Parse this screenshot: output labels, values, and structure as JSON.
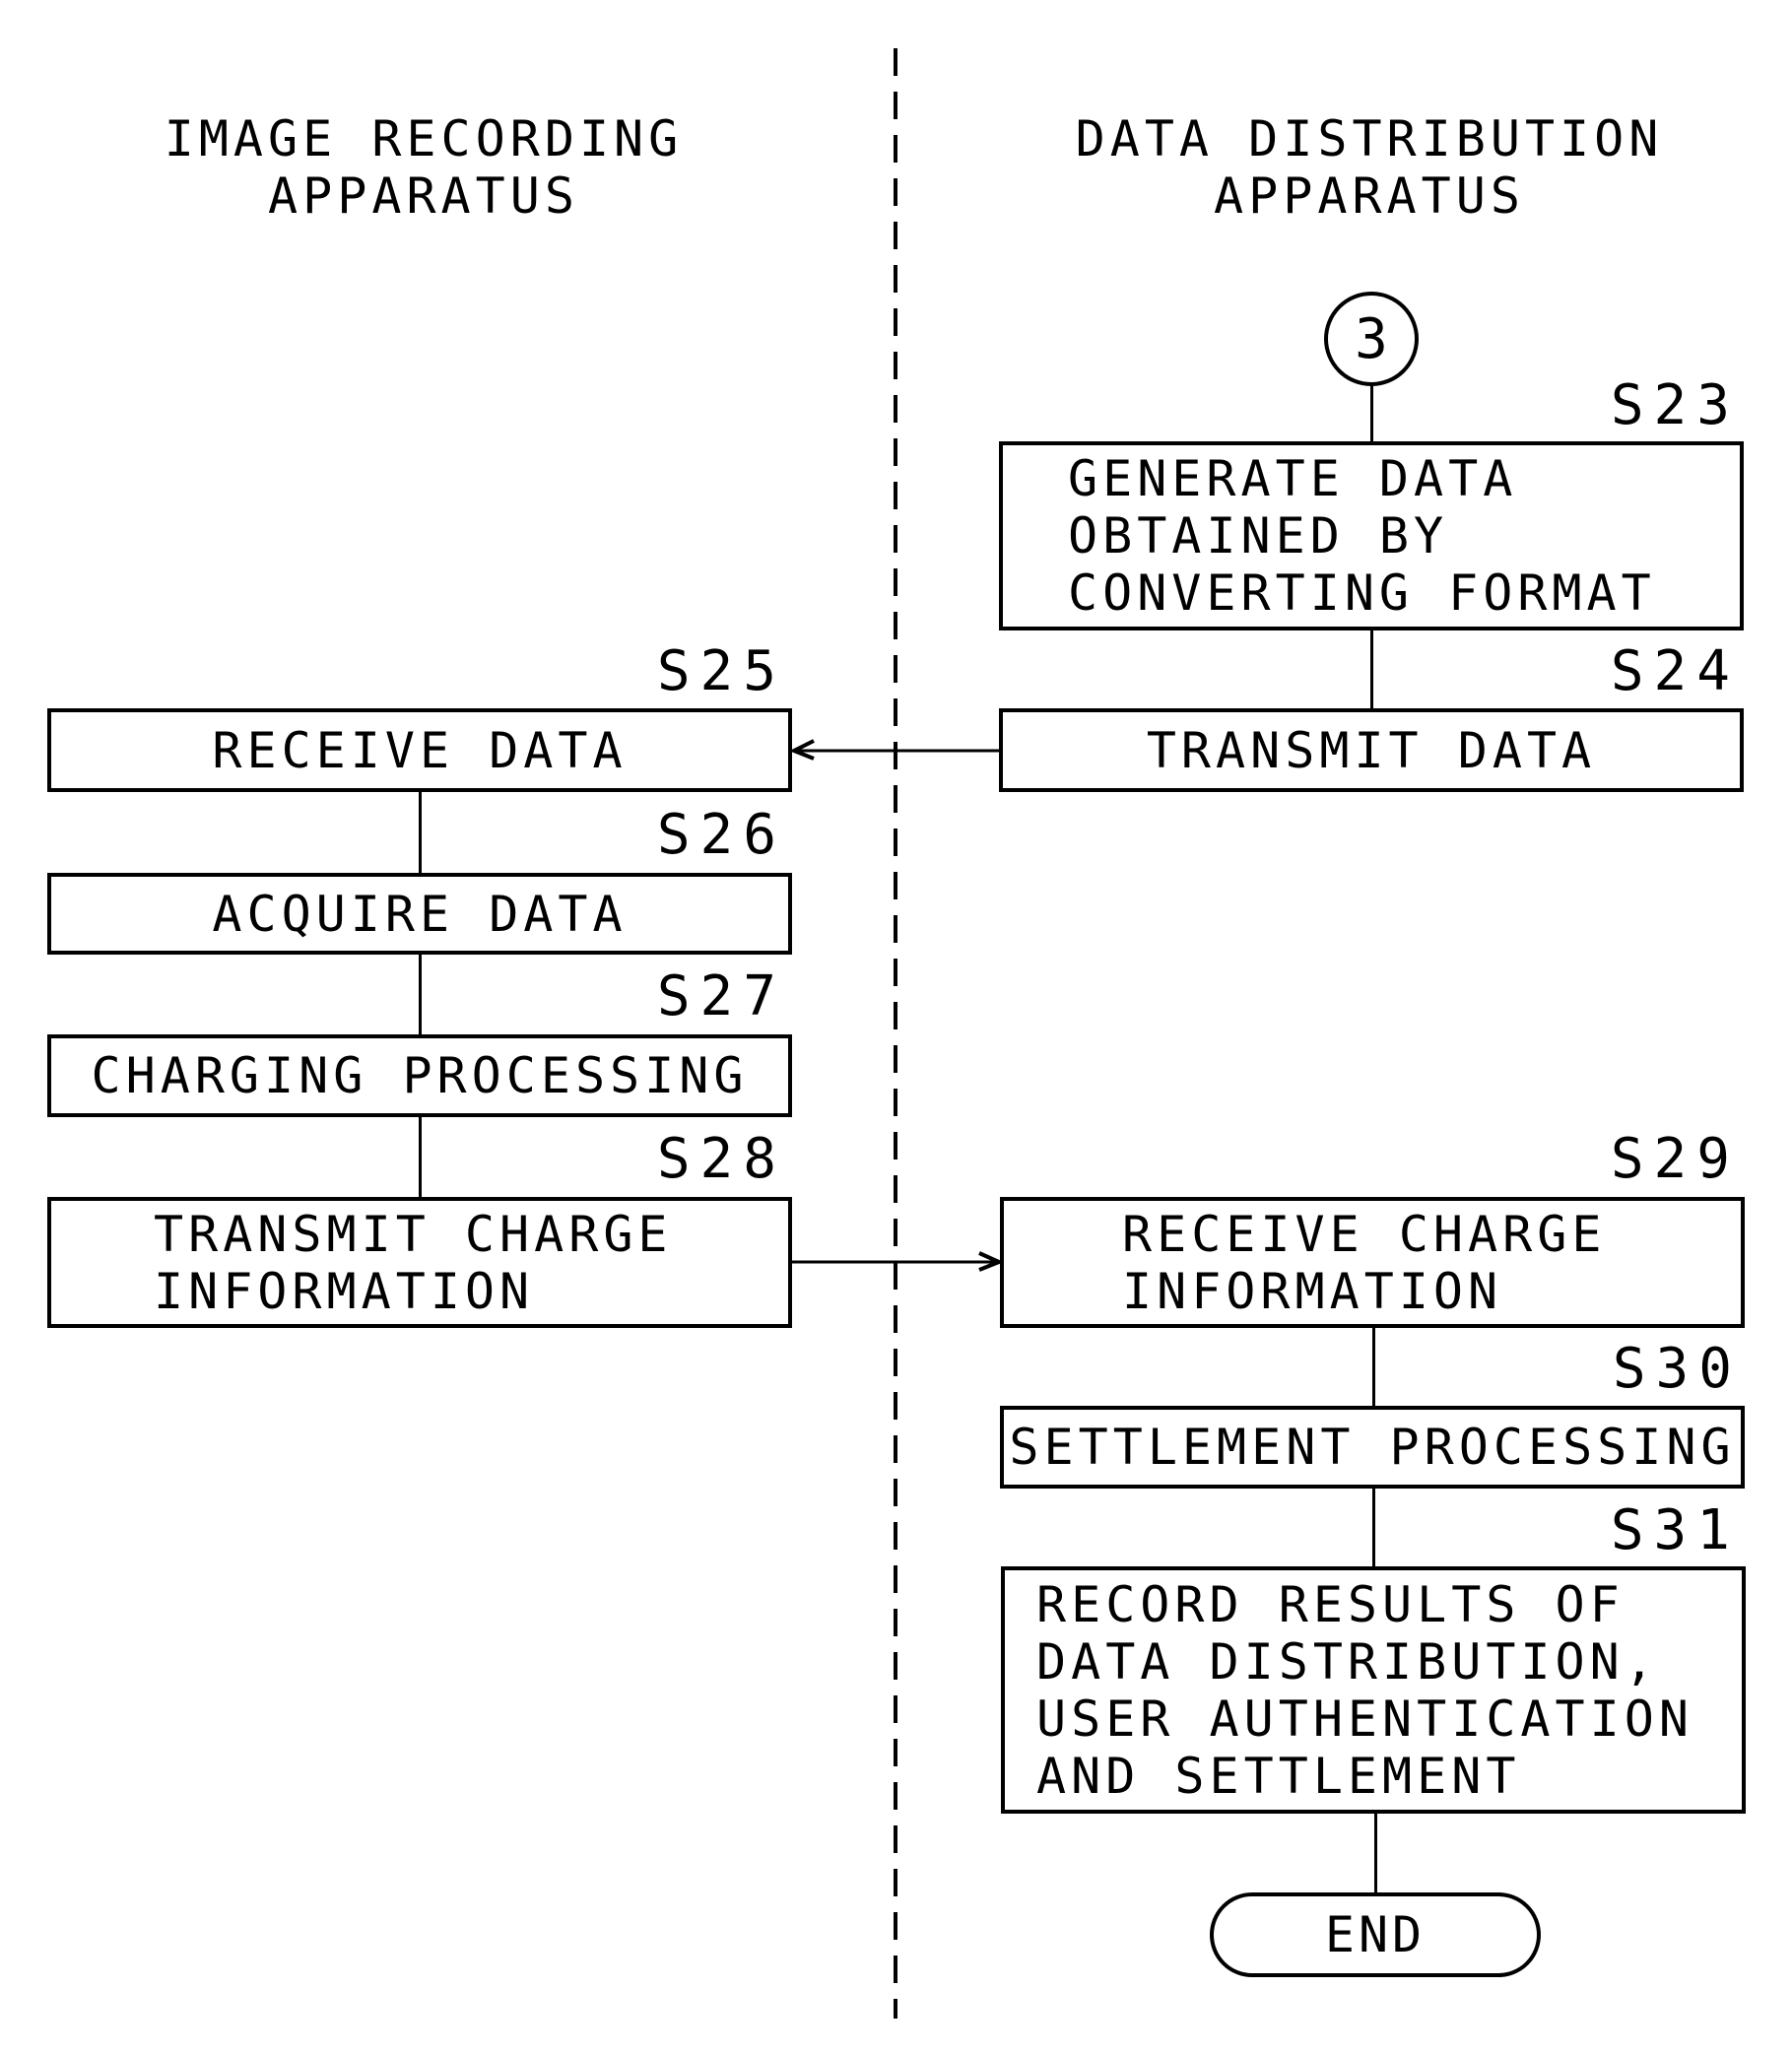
{
  "lanes": {
    "left": {
      "title": "IMAGE RECORDING\nAPPARATUS"
    },
    "right": {
      "title": "DATA DISTRIBUTION\nAPPARATUS"
    }
  },
  "connector": {
    "label": "3"
  },
  "steps": {
    "s23": {
      "id": "S23",
      "text": "GENERATE DATA\nOBTAINED BY\nCONVERTING FORMAT"
    },
    "s24": {
      "id": "S24",
      "text": "TRANSMIT DATA"
    },
    "s25": {
      "id": "S25",
      "text": "RECEIVE DATA"
    },
    "s26": {
      "id": "S26",
      "text": "ACQUIRE DATA"
    },
    "s27": {
      "id": "S27",
      "text": "CHARGING PROCESSING"
    },
    "s28": {
      "id": "S28",
      "text": "TRANSMIT CHARGE\nINFORMATION"
    },
    "s29": {
      "id": "S29",
      "text": "RECEIVE CHARGE\nINFORMATION"
    },
    "s30": {
      "id": "S30",
      "text": "SETTLEMENT PROCESSING"
    },
    "s31": {
      "id": "S31",
      "text": "RECORD RESULTS OF\nDATA DISTRIBUTION,\nUSER AUTHENTICATION\nAND SETTLEMENT"
    }
  },
  "terminal": {
    "label": "END"
  }
}
